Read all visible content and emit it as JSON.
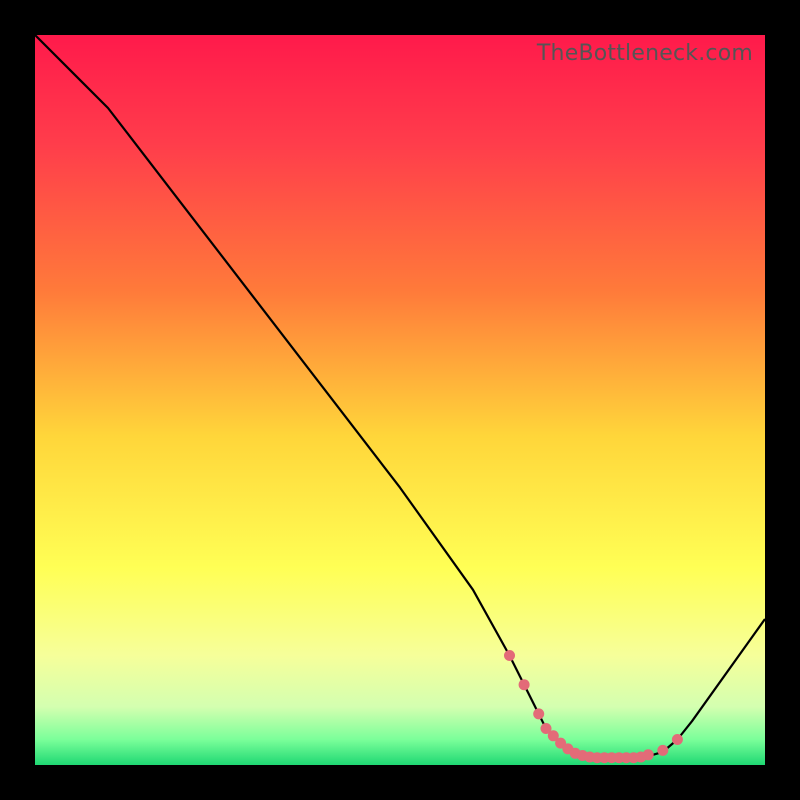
{
  "watermark": "TheBottleneck.com",
  "chart_data": {
    "type": "line",
    "title": "",
    "xlabel": "",
    "ylabel": "",
    "xlim": [
      0,
      100
    ],
    "ylim": [
      0,
      100
    ],
    "grid": false,
    "legend": false,
    "series": [
      {
        "name": "bottleneck-curve",
        "color": "#000000",
        "x": [
          0,
          6,
          10,
          20,
          30,
          40,
          50,
          60,
          65,
          68,
          70,
          72,
          74,
          76,
          78,
          80,
          82,
          84,
          86,
          88,
          90,
          100
        ],
        "y": [
          100,
          94,
          90,
          77,
          64,
          51,
          38,
          24,
          15,
          9,
          5,
          3,
          2,
          1.2,
          1.0,
          1.0,
          1.0,
          1.2,
          1.8,
          3.5,
          6,
          20
        ]
      },
      {
        "name": "highlight-dots",
        "color": "#e36b78",
        "type": "scatter",
        "x": [
          65,
          67,
          69,
          70,
          71,
          72,
          73,
          74,
          75,
          76,
          77,
          78,
          79,
          80,
          81,
          82,
          83,
          84,
          86,
          88
        ],
        "y": [
          15,
          11,
          7,
          5.0,
          4.0,
          3.0,
          2.2,
          1.6,
          1.3,
          1.1,
          1.0,
          1.0,
          1.0,
          1.0,
          1.0,
          1.0,
          1.1,
          1.4,
          2.0,
          3.5
        ]
      }
    ],
    "gradient_stops": [
      {
        "pos": 0.0,
        "color": "#ff1a4b"
      },
      {
        "pos": 0.15,
        "color": "#ff3d4b"
      },
      {
        "pos": 0.35,
        "color": "#ff7a3a"
      },
      {
        "pos": 0.55,
        "color": "#ffd63a"
      },
      {
        "pos": 0.73,
        "color": "#ffff55"
      },
      {
        "pos": 0.85,
        "color": "#f6ff9a"
      },
      {
        "pos": 0.92,
        "color": "#d4ffb0"
      },
      {
        "pos": 0.965,
        "color": "#7bff9a"
      },
      {
        "pos": 1.0,
        "color": "#1fd873"
      }
    ]
  }
}
